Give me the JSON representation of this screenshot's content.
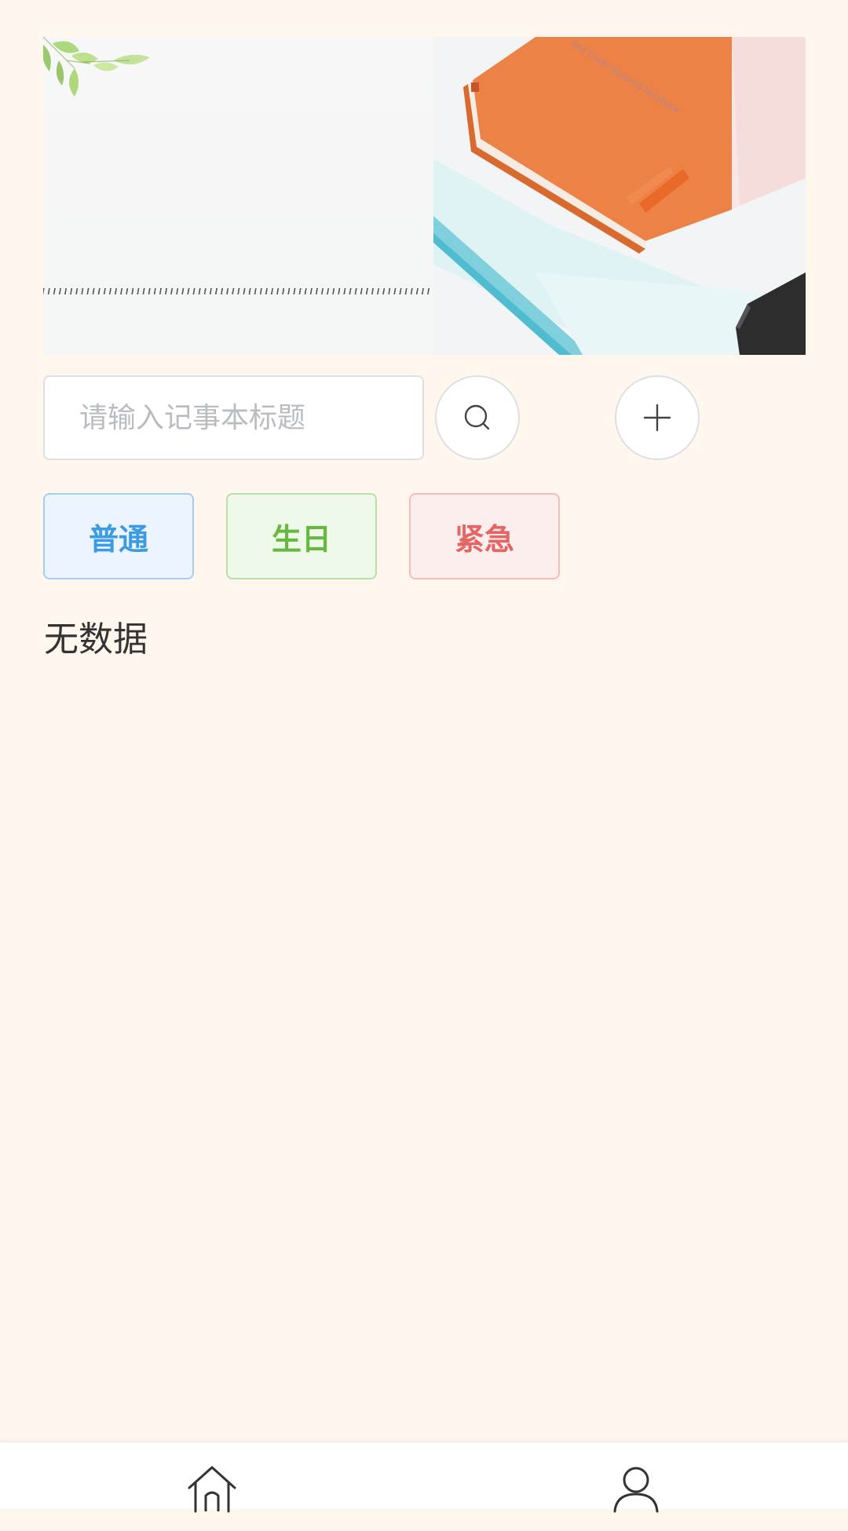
{
  "banner": {
    "image_alt": "notebook banner",
    "notebook_caption": "and Cover Squared Notebook"
  },
  "search": {
    "placeholder": "请输入记事本标题",
    "value": ""
  },
  "icons": {
    "search_button": "search-icon",
    "add_button": "plus-icon",
    "tab_home": "home-icon",
    "tab_mine": "user-icon"
  },
  "categories": [
    {
      "label": "普通",
      "color": "#3d9be3"
    },
    {
      "label": "生日",
      "color": "#67b83f"
    },
    {
      "label": "紧急",
      "color": "#e56464"
    }
  ],
  "list": {
    "empty_text": "无数据"
  },
  "colors": {
    "page_background": "#fff7ee",
    "tabbar_background": "#ffffff"
  }
}
